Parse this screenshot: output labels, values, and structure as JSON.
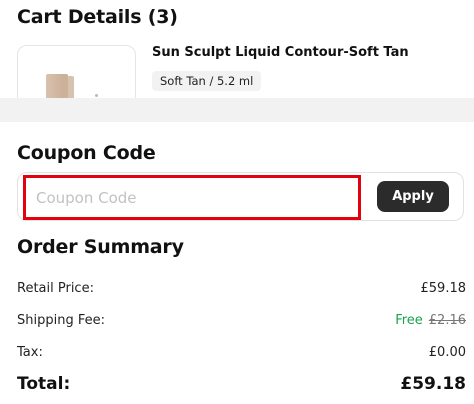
{
  "cart": {
    "title": "Cart Details (3)",
    "product": {
      "name": "Sun Sculpt Liquid Contour-Soft Tan",
      "variant": "Soft Tan / 5.2 ml"
    }
  },
  "coupon": {
    "title": "Coupon Code",
    "placeholder": "Coupon Code",
    "value": "",
    "apply_label": "Apply"
  },
  "summary": {
    "title": "Order Summary",
    "retail_label": "Retail Price:",
    "retail_value": "£59.18",
    "shipping_label": "Shipping Fee:",
    "shipping_free": "Free",
    "shipping_original": "£2.16",
    "tax_label": "Tax:",
    "tax_value": "£0.00",
    "total_label": "Total:",
    "total_value": "£59.18"
  },
  "colors": {
    "accent_red": "#e3000f",
    "free_green": "#1aa34a",
    "button_dark": "#2b2b2b"
  },
  "icons": {
    "product_image": "product-thumbnail-image"
  }
}
